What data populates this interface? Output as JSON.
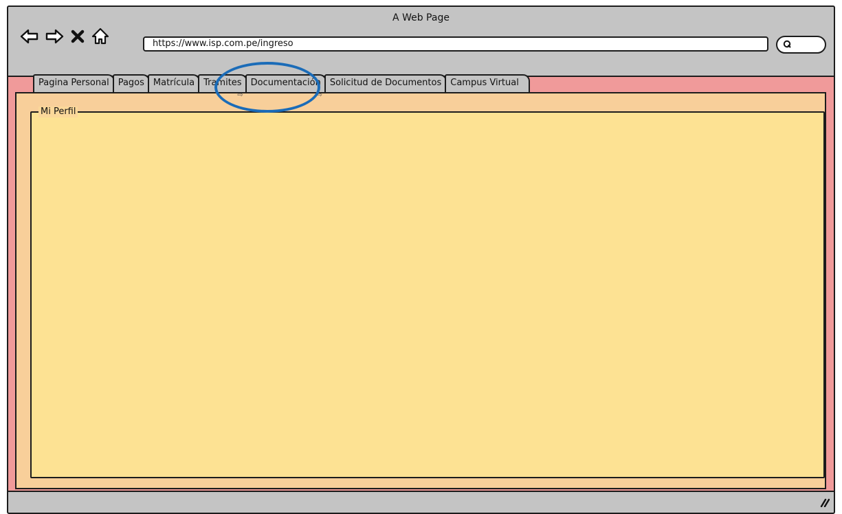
{
  "window": {
    "title": "A Web Page"
  },
  "toolbar": {
    "back_icon": "back-arrow-icon",
    "forward_icon": "forward-arrow-icon",
    "stop_icon": "close-icon",
    "home_icon": "home-icon",
    "url": "https://www.isp.com.pe/ingreso",
    "search_icon": "search-icon"
  },
  "tabs": [
    {
      "label": "Pagina Personal",
      "has_arrow": false
    },
    {
      "label": "Pagos",
      "has_arrow": false
    },
    {
      "label": "Matrícula",
      "has_arrow": false
    },
    {
      "label": "Tramites",
      "has_arrow": true
    },
    {
      "label": "Documentación",
      "has_arrow": true
    },
    {
      "label": "Solicitud de Documentos",
      "has_arrow": false
    },
    {
      "label": "Campus Virtual",
      "has_arrow": false
    }
  ],
  "annotation": {
    "highlighted_tab": "Tramites",
    "color": "#1b6cb8"
  },
  "panel": {
    "legend": "Mi Perfil"
  },
  "colors": {
    "chrome": "#c4c4c4",
    "tab_area": "#f09a9a",
    "panel": "#f8cf9a",
    "fieldset": "#fde293"
  }
}
